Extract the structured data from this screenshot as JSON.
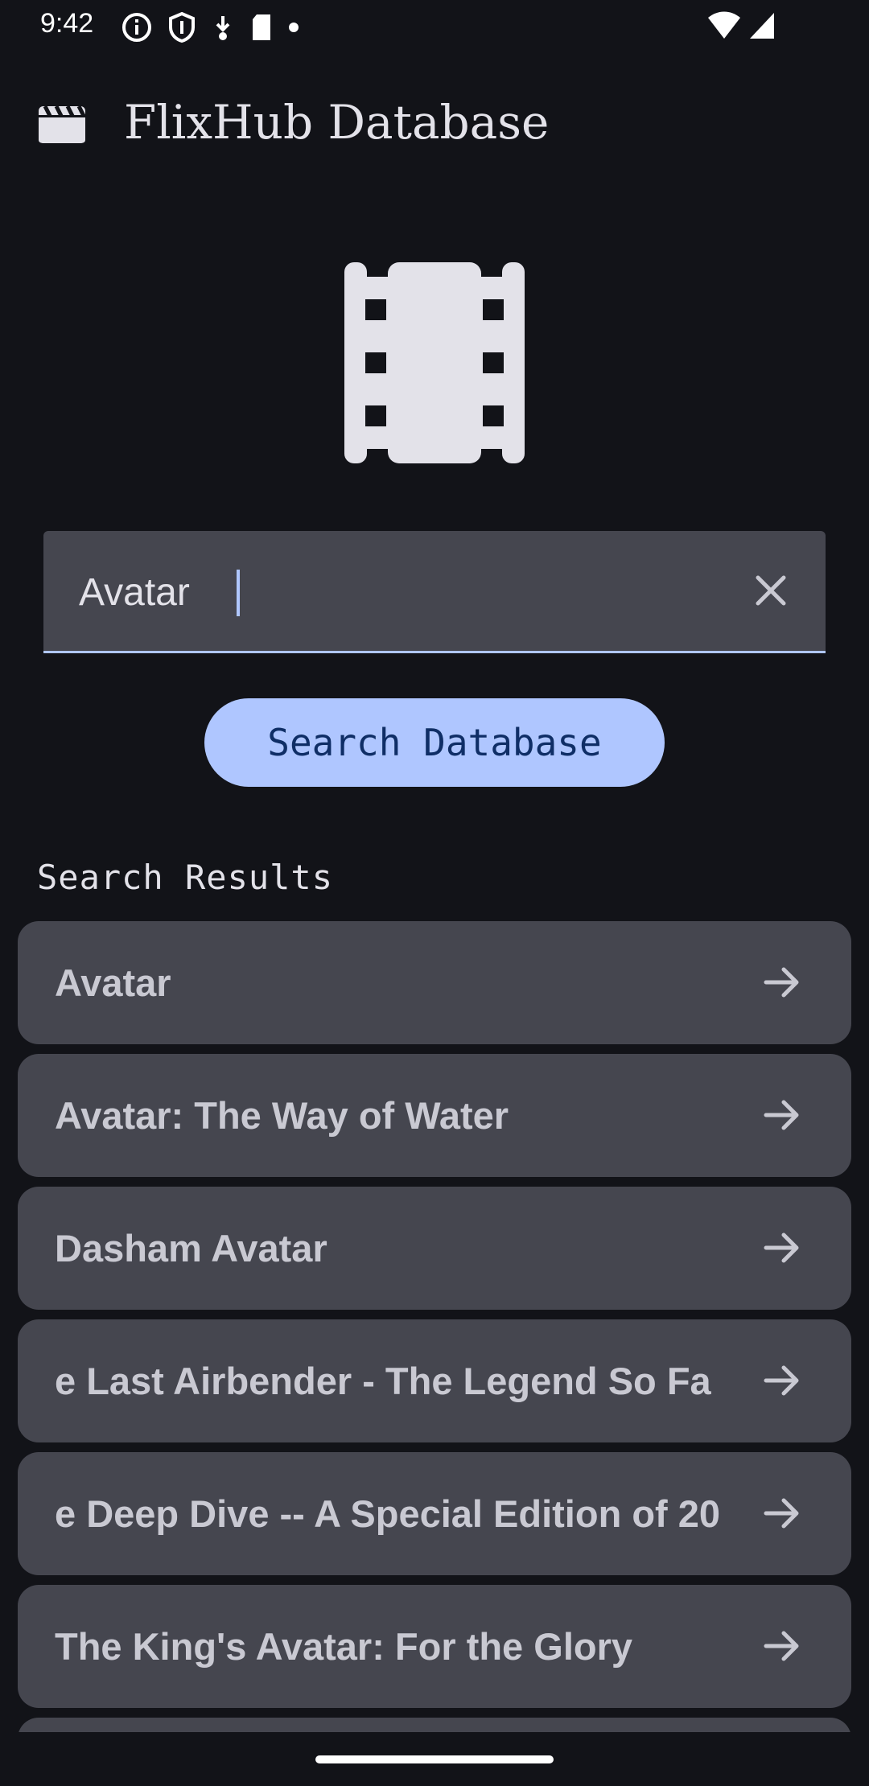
{
  "status_bar": {
    "time": "9:42",
    "left_icons": [
      "info-icon",
      "shield-icon",
      "download-icon",
      "sd-card-icon",
      "dot-icon"
    ],
    "right_icons": [
      "wifi-icon",
      "signal-icon"
    ]
  },
  "app_bar": {
    "icon": "clapperboard-icon",
    "title": "FlixHub Database"
  },
  "hero": {
    "icon": "film-strip-icon"
  },
  "search": {
    "value": "Avatar",
    "clear_icon": "close-icon",
    "button_label": "Search Database"
  },
  "results": {
    "heading": "Search Results",
    "items": [
      {
        "title": "Avatar"
      },
      {
        "title": "Avatar: The Way of Water"
      },
      {
        "title": "Dasham Avatar"
      },
      {
        "title": "e Last Airbender - The Legend So Fa"
      },
      {
        "title": "e Deep Dive -- A Special Edition of 20"
      },
      {
        "title": "The King's Avatar: For the Glory"
      }
    ]
  },
  "colors": {
    "background": "#121318",
    "surface": "#45464f",
    "accent": "#afc6ff",
    "on_accent": "#0f2e66"
  }
}
